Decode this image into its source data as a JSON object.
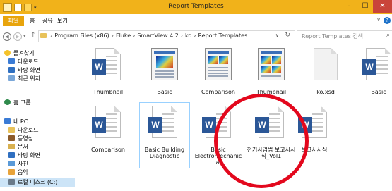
{
  "window": {
    "title": "Report Templates",
    "min_label": "–",
    "max_label": "☐",
    "close_label": "✕",
    "title_bar_color": "#f1b21a"
  },
  "ribbon": {
    "tabs": [
      {
        "label": "파일",
        "active": true
      },
      {
        "label": "홈"
      },
      {
        "label": "공유"
      },
      {
        "label": "보기"
      }
    ],
    "expand_label": "∨",
    "help_label": "?"
  },
  "address_bar": {
    "crumbs": [
      "Program Files (x86)",
      "Fluke",
      "SmartView 4.2",
      "ko",
      "Report Templates"
    ],
    "search_placeholder": "Report Templates 검색"
  },
  "nav_pane": {
    "favorites_label": "즐겨찾기",
    "favorites": [
      "다운로드",
      "바탕 화면",
      "최근 위치"
    ],
    "homegroup_label": "홈 그룹",
    "this_pc_label": "내 PC",
    "this_pc_items": [
      "다운로드",
      "동영상",
      "문서",
      "바탕 화면",
      "사진",
      "음악",
      "로컬 디스크 (C:)"
    ]
  },
  "files_row1": [
    {
      "name": "Thumbnail",
      "icon": "word-doc-icon"
    },
    {
      "name": "Basic",
      "icon": "report-thumb-icon"
    },
    {
      "name": "Comparison",
      "icon": "comparison-thumb-icon"
    },
    {
      "name": "Thumbnail",
      "icon": "comparison-thumb-icon"
    },
    {
      "name": "ko.xsd",
      "icon": "blank-file-icon"
    },
    {
      "name": "Basic",
      "icon": "word-doc-icon"
    }
  ],
  "files_row2": [
    {
      "name": "Comparison",
      "icon": "word-doc-icon"
    },
    {
      "name": "Basic Building Diagnostic",
      "icon": "word-doc-icon",
      "selected": true
    },
    {
      "name": "Basic Electromechanical",
      "icon": "word-doc-icon"
    },
    {
      "name": "전기사업법 보고서서식_Vol1",
      "icon": "word-doc-icon"
    },
    {
      "name": "보고서서식",
      "icon": "word-doc-icon"
    }
  ],
  "colors": {
    "word_blue": "#2b5797",
    "annotation_red": "#e3081d",
    "selection_blue": "#cce4f7"
  }
}
